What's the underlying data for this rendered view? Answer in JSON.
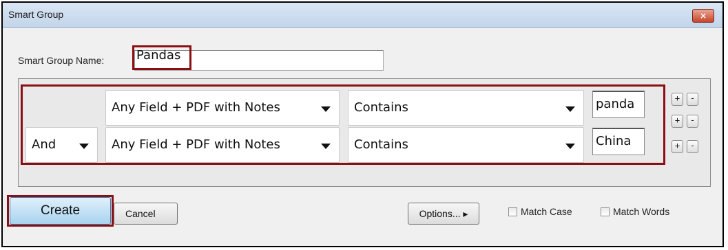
{
  "window": {
    "title": "Smart Group",
    "close_label": "×"
  },
  "name_field": {
    "label": "Smart Group Name:",
    "value": "Pandas"
  },
  "rules": [
    {
      "connector": "",
      "field": "Any Field + PDF with Notes",
      "operator": "Contains",
      "value": "panda"
    },
    {
      "connector": "And",
      "field": "Any Field + PDF with Notes",
      "operator": "Contains",
      "value": "China"
    }
  ],
  "row_controls": {
    "add_label": "+",
    "remove_label": "-"
  },
  "buttons": {
    "create": "Create",
    "cancel": "Cancel",
    "options": "Options... ▸"
  },
  "checkboxes": {
    "match_case": "Match Case",
    "match_words": "Match Words"
  },
  "colors": {
    "highlight": "#8b0e12",
    "create_button": "#a9d3ef"
  }
}
